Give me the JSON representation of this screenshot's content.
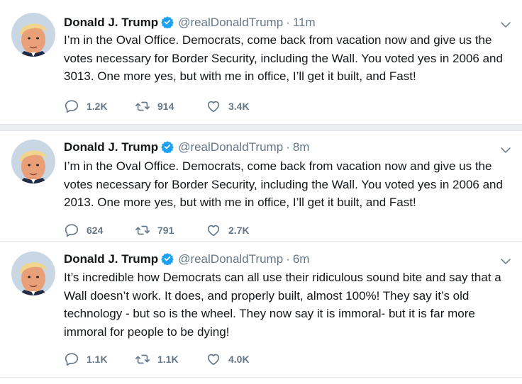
{
  "tweets": [
    {
      "name": "Donald J. Trump",
      "handle": "@realDonaldTrump",
      "separator": "·",
      "time": "11m",
      "text": "I’m in the Oval Office. Democrats, come back from vacation now and give us the votes necessary for Border Security, including the Wall. You voted yes in 2006 and 3013. One more yes, but with me in office, I’ll get it built, and Fast!",
      "replies": "1.2K",
      "retweets": "914",
      "likes": "3.4K"
    },
    {
      "name": "Donald J. Trump",
      "handle": "@realDonaldTrump",
      "separator": "·",
      "time": "8m",
      "text": "I’m in the Oval Office. Democrats, come back from vacation now and give us the votes necessary for Border Security, including the Wall. You voted yes in 2006 and 2013. One more yes, but with me in office, I’ll get it built, and Fast!",
      "replies": "624",
      "retweets": "791",
      "likes": "2.7K"
    },
    {
      "name": "Donald J. Trump",
      "handle": "@realDonaldTrump",
      "separator": "·",
      "time": "6m",
      "text": "It’s incredible how Democrats can all use their ridiculous sound bite and say that a Wall doesn’t work. It does, and properly built, almost 100%! They say it’s old technology - but so is the wheel. They now say it is immoral- but it is far more immoral for people to be dying!",
      "replies": "1.1K",
      "retweets": "1.1K",
      "likes": "4.0K"
    }
  ],
  "colors": {
    "verified": "#1da1f2",
    "muted": "#657786",
    "text": "#14171a",
    "separator": "#eceff1"
  },
  "icons": [
    "verified-badge-icon",
    "chevron-down-icon",
    "reply-icon",
    "retweet-icon",
    "like-icon"
  ]
}
